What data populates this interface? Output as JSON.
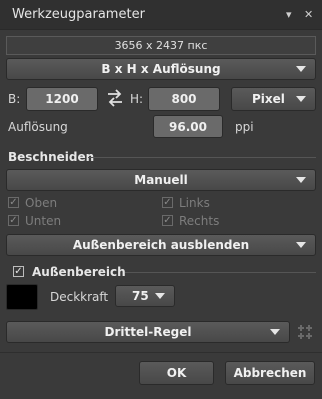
{
  "window": {
    "title": "Werkzeugparameter"
  },
  "image_size_display": "3656 x 2437 пкс",
  "mode_select": "B x H x Auflösung",
  "dims": {
    "b_label": "B:",
    "b_value": "1200",
    "h_label": "H:",
    "h_value": "800",
    "unit_select": "Pixel"
  },
  "resolution": {
    "label": "Auflösung",
    "value": "96.00",
    "unit": "ppi"
  },
  "crop": {
    "section_title": "Beschneiden",
    "mode_select": "Manuell",
    "options": {
      "top": "Oben",
      "bottom": "Unten",
      "left": "Links",
      "right": "Rechts"
    },
    "outside_select": "Außenbereich ausblenden"
  },
  "outside": {
    "section_title": "Außenbereich",
    "opacity_label": "Deckkraft",
    "opacity_value": "75",
    "color": "#000000"
  },
  "guides_select": "Drittel-Regel",
  "footer": {
    "ok": "OK",
    "cancel": "Abbrechen"
  }
}
